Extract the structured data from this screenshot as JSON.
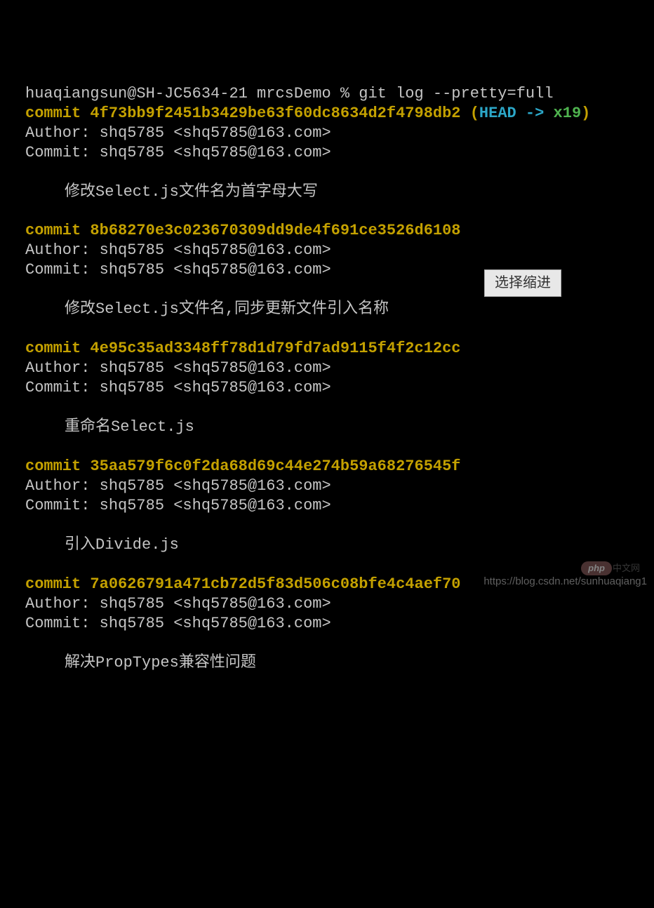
{
  "prompt": "huaqiangsun@SH-JC5634-21 mrcsDemo % git log --pretty=full",
  "head_ref": "HEAD -> ",
  "branch": "x19",
  "commits": [
    {
      "hash": "commit 4f73bb9f2451b3429be63f60dc8634d2f4798db2",
      "author": "Author: shq5785 <shq5785@163.com>",
      "committer": "Commit: shq5785 <shq5785@163.com>",
      "message": "修改Select.js文件名为首字母大写",
      "is_head": true
    },
    {
      "hash": "commit 8b68270e3c023670309dd9de4f691ce3526d6108",
      "author": "Author: shq5785 <shq5785@163.com>",
      "committer": "Commit: shq5785 <shq5785@163.com>",
      "message": "修改Select.js文件名,同步更新文件引入名称",
      "is_head": false
    },
    {
      "hash": "commit 4e95c35ad3348ff78d1d79fd7ad9115f4f2c12cc",
      "author": "Author: shq5785 <shq5785@163.com>",
      "committer": "Commit: shq5785 <shq5785@163.com>",
      "message": "重命名Select.js",
      "is_head": false
    },
    {
      "hash": "commit 35aa579f6c0f2da68d69c44e274b59a68276545f",
      "author": "Author: shq5785 <shq5785@163.com>",
      "committer": "Commit: shq5785 <shq5785@163.com>",
      "message": "引入Divide.js",
      "is_head": false
    },
    {
      "hash": "commit 7a0626791a471cb72d5f83d506c08bfe4c4aef70",
      "author": "Author: shq5785 <shq5785@163.com>",
      "committer": "Commit: shq5785 <shq5785@163.com>",
      "message": "解决PropTypes兼容性问题",
      "is_head": false
    }
  ],
  "tooltip": "选择缩进",
  "watermark": "https://blog.csdn.net/sunhuaqiang1",
  "php_badge": "php",
  "php_badge_side": "中文网"
}
